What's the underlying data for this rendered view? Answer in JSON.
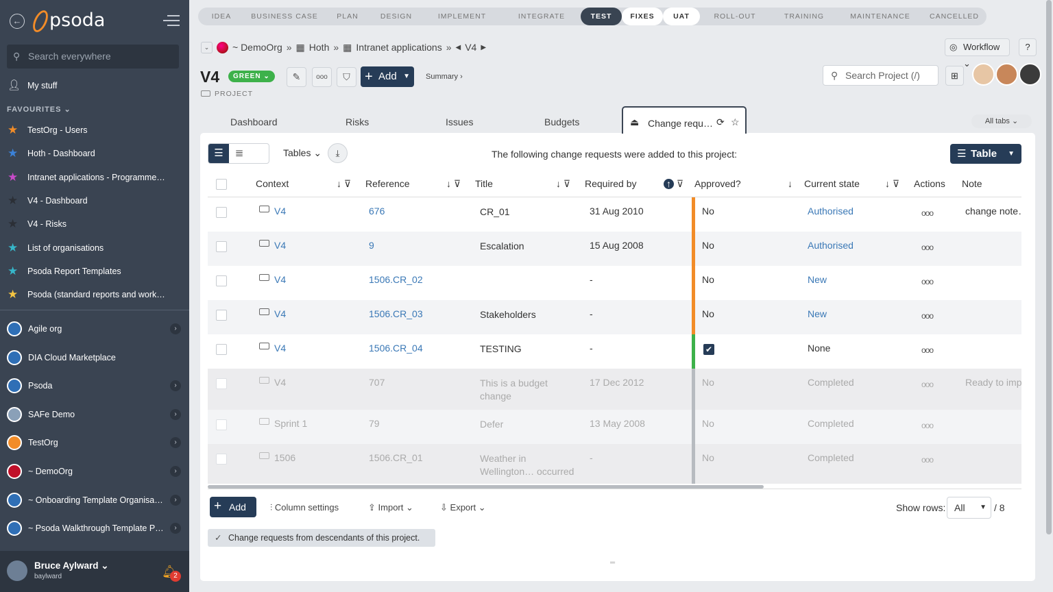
{
  "sidebar": {
    "logo_text": "psoda",
    "search_placeholder": "Search everywhere",
    "my_stuff": "My stuff",
    "favourites_heading": "FAVOURITES",
    "favourites": [
      {
        "label": "TestOrg - Users",
        "star_color": "#f28c28"
      },
      {
        "label": "Hoth - Dashboard",
        "star_color": "#3b82d8"
      },
      {
        "label": "Intranet applications - Programme…",
        "star_color": "#c84bc8"
      },
      {
        "label": "V4 - Dashboard",
        "star_color": "#2b2f36"
      },
      {
        "label": "V4 - Risks",
        "star_color": "#2b2f36"
      },
      {
        "label": "List of organisations",
        "star_color": "#36b6c9"
      },
      {
        "label": "Psoda Report Templates",
        "star_color": "#36b6c9"
      },
      {
        "label": "Psoda (standard reports and work…",
        "star_color": "#f5c542"
      }
    ],
    "orgs": [
      {
        "label": "Agile org",
        "chevron": true
      },
      {
        "label": "DIA Cloud Marketplace",
        "chevron": false
      },
      {
        "label": "Psoda",
        "chevron": true
      },
      {
        "label": "SAFe Demo",
        "chevron": true
      },
      {
        "label": "TestOrg",
        "chevron": true
      },
      {
        "label": "~ DemoOrg",
        "chevron": true
      },
      {
        "label": "~ Onboarding Template Organisa…",
        "chevron": true
      },
      {
        "label": "~ Psoda Walkthrough Template P…",
        "chevron": true
      }
    ],
    "user": {
      "name": "Bruce Aylward",
      "login": "baylward",
      "notifications": "2"
    }
  },
  "phases": [
    {
      "label": "IDEA",
      "state": "done"
    },
    {
      "label": "BUSINESS CASE",
      "state": "done"
    },
    {
      "label": "PLAN",
      "state": "done"
    },
    {
      "label": "DESIGN",
      "state": "done"
    },
    {
      "label": "IMPLEMENT",
      "state": "done"
    },
    {
      "label": "INTEGRATE",
      "state": "done"
    },
    {
      "label": "TEST",
      "state": "active"
    },
    {
      "label": "FIXES",
      "state": "current"
    },
    {
      "label": "UAT",
      "state": "current"
    },
    {
      "label": "ROLL-OUT",
      "state": "todo"
    },
    {
      "label": "TRAINING",
      "state": "todo"
    },
    {
      "label": "MAINTENANCE",
      "state": "todo"
    },
    {
      "label": "CANCELLED",
      "state": "todo"
    }
  ],
  "breadcrumb": [
    "~ DemoOrg",
    "Hoth",
    "Intranet applications",
    "V4"
  ],
  "header": {
    "workflow": "Workflow",
    "help": "?",
    "title": "V4",
    "status": "GREEN",
    "type": "PROJECT",
    "add": "Add",
    "summary": "Summary ›",
    "search_project": "Search Project (/)"
  },
  "tabs": {
    "items": [
      "Dashboard",
      "Risks",
      "Issues",
      "Budgets"
    ],
    "active": "Change requ…",
    "all_tabs": "All tabs"
  },
  "toolbar": {
    "tables": "Tables",
    "intro": "The following change requests were added to this project:",
    "table_btn": "Table"
  },
  "table": {
    "columns": [
      "Context",
      "Reference",
      "Title",
      "Required by",
      "Approved?",
      "Current state",
      "Actions",
      "Note"
    ],
    "rows": [
      {
        "context": "V4",
        "reference": "676",
        "title": "CR_01",
        "required_by": "31 Aug 2010",
        "approved": "No",
        "state": "Authorised",
        "note": "change note…",
        "bar": "#f28c28",
        "dim": false
      },
      {
        "context": "V4",
        "reference": "9",
        "title": "Escalation",
        "required_by": "15 Aug 2008",
        "approved": "No",
        "state": "Authorised",
        "note": "",
        "bar": "#f28c28",
        "dim": false
      },
      {
        "context": "V4",
        "reference": "1506.CR_02",
        "title": "",
        "required_by": "-",
        "approved": "No",
        "state": "New",
        "note": "",
        "bar": "#f28c28",
        "dim": false
      },
      {
        "context": "V4",
        "reference": "1506.CR_03",
        "title": "Stakeholders",
        "required_by": "-",
        "approved": "No",
        "state": "New",
        "note": "",
        "bar": "#f28c28",
        "dim": false
      },
      {
        "context": "V4",
        "reference": "1506.CR_04",
        "title": "TESTING",
        "required_by": "-",
        "approved": "✔",
        "state": "None",
        "note": "",
        "bar": "#3db14a",
        "dim": false
      },
      {
        "context": "V4",
        "reference": "707",
        "title": "This is a budget change",
        "required_by": "17 Dec 2012",
        "approved": "No",
        "state": "Completed",
        "note": "Ready to imp…",
        "bar": "#b7bbc0",
        "dim": true
      },
      {
        "context": "Sprint 1",
        "reference": "79",
        "title": "Defer",
        "required_by": "13 May 2008",
        "approved": "No",
        "state": "Completed",
        "note": "",
        "bar": "#b7bbc0",
        "dim": true
      },
      {
        "context": "1506",
        "reference": "1506.CR_01",
        "title": "Weather in Wellington… occurred",
        "required_by": "-",
        "approved": "No",
        "state": "Completed",
        "note": "",
        "bar": "#b7bbc0",
        "dim": true
      }
    ]
  },
  "footer": {
    "add": "Add",
    "column_settings": "Column settings",
    "import": "Import",
    "export": "Export",
    "show_rows_label": "Show rows:",
    "show_rows_value": "All",
    "total": "/ 8",
    "descendants": "Change requests from descendants of this project."
  }
}
